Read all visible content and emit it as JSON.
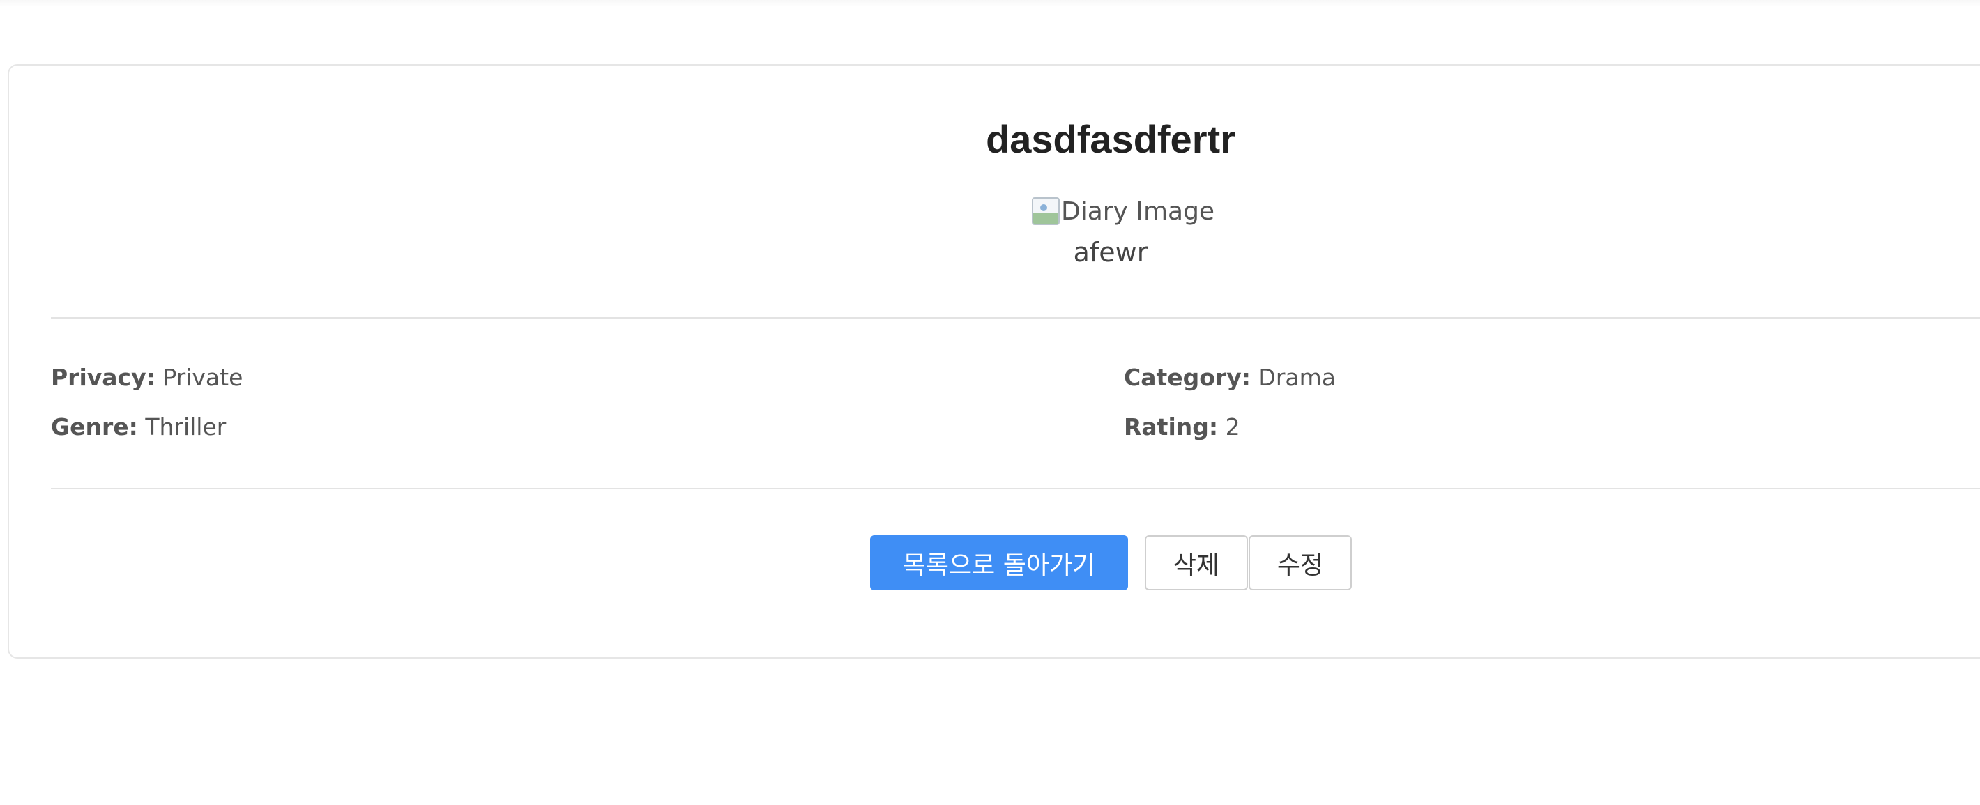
{
  "diary": {
    "title": "dasdfasdfertr",
    "image_alt": "Diary Image",
    "content": "afewr"
  },
  "details": {
    "privacy_label": "Privacy:",
    "privacy_value": "Private",
    "category_label": "Category:",
    "category_value": "Drama",
    "genre_label": "Genre:",
    "genre_value": "Thriller",
    "rating_label": "Rating:",
    "rating_value": "2"
  },
  "actions": {
    "back_label": "목록으로 돌아가기",
    "delete_label": "삭제",
    "edit_label": "수정"
  },
  "colors": {
    "primary": "#3f8ef5",
    "border": "#e6e6e6",
    "text": "#555555"
  },
  "icons": {
    "image_placeholder": "broken-image-icon"
  }
}
